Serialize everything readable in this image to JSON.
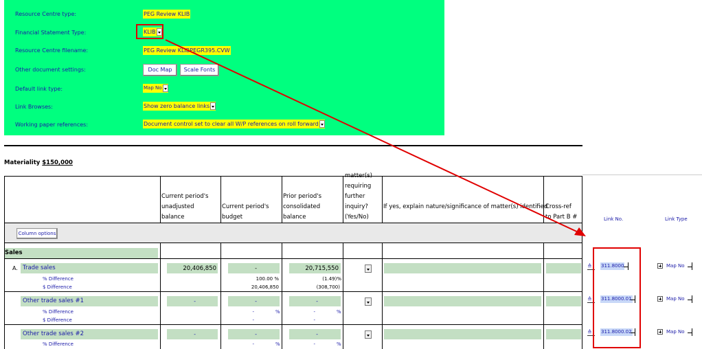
{
  "settings": {
    "resource_centre_type_label": "Resource Centre type:",
    "resource_centre_type_value": "PEG Review KLIB",
    "financial_statement_type_label": "Financial Statement Type:",
    "financial_statement_type_value": "KLIB",
    "resource_centre_filename_label": "Resource Centre filename:",
    "resource_centre_filename_value": "PEG Review KLIBPEGR395.CVW",
    "other_document_settings_label": "Other document settings:",
    "doc_map_button": "Doc Map",
    "scale_fonts_button": "Scale Fonts",
    "default_link_type_label": "Default link type:",
    "default_link_type_value": "Map No",
    "link_browses_label": "Link Browses:",
    "link_browses_value": "Show zero balance links",
    "working_paper_references_label": "Working paper references:",
    "working_paper_references_value": "Document control set to clear all W/P references on roll forward"
  },
  "materiality": {
    "label": "Materiality",
    "value": "$150,000"
  },
  "table": {
    "headers": {
      "current_unadjusted": [
        "Current period's",
        "unadjusted",
        "balance"
      ],
      "current_budget": [
        "Current period's",
        "budget"
      ],
      "prior_consolidated": [
        "Prior period's",
        "consolidated",
        "balance"
      ],
      "matters": [
        "matter(s)",
        "requiring",
        "further",
        "inquiry?",
        "(Yes/No)"
      ],
      "explain": "If yes, explain nature/significance of matter(s) identified",
      "crossref": [
        "Cross-ref",
        "to Part B #"
      ],
      "link_no": "Link No.",
      "link_type": "Link Type"
    },
    "column_options_button": "Column options",
    "section_title": "Sales",
    "rows": [
      {
        "prefix": "A.",
        "label": "Trade sales",
        "current": "20,406,850",
        "budget": "-",
        "prior": "20,715,550",
        "pct_label": "% Difference",
        "pct_budget": "100.00 %",
        "pct_prior": "(1.49)%",
        "dollar_label": "$ Difference",
        "dollar_budget": "20,406,850",
        "dollar_prior": "(308,700)",
        "link_no": "311.8000",
        "link_type": "Map No"
      },
      {
        "prefix": "",
        "label": "Other trade sales #1",
        "current": "-",
        "budget": "-",
        "prior": "-",
        "pct_label": "% Difference",
        "pct_budget": "-",
        "pct_budget_unit": "%",
        "pct_prior": "-",
        "pct_prior_unit": "%",
        "dollar_label": "$ Difference",
        "dollar_budget": "-",
        "dollar_prior": "-",
        "link_no": "311.8000.01",
        "link_type": "Map No"
      },
      {
        "prefix": "",
        "label": "Other trade sales #2",
        "current": "-",
        "budget": "-",
        "prior": "-",
        "pct_label": "% Difference",
        "pct_budget": "-",
        "pct_budget_unit": "%",
        "pct_prior": "-",
        "pct_prior_unit": "%",
        "link_no": "311.8000.02",
        "link_type": "Map No"
      }
    ]
  },
  "colors": {
    "settings_bg": "#00ff7f",
    "highlight": "#ffff00",
    "annotation": "#e00000",
    "cell_green": "#c3dfc3"
  }
}
